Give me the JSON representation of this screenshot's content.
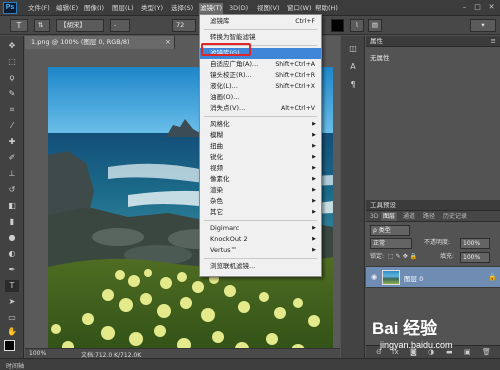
{
  "menubar": {
    "logo": "Ps",
    "items": [
      "文件(F)",
      "编辑(E)",
      "图像(I)",
      "图层(L)",
      "类型(Y)",
      "选择(S)",
      "滤镜(T)",
      "3D(D)",
      "视图(V)",
      "窗口(W)",
      "帮助(H)"
    ],
    "active_index": 6
  },
  "optbar": {
    "font_family": "【胡宋】",
    "font_style": "-",
    "font_size": "72"
  },
  "document": {
    "tab_title": "1.png @ 100% (图层 0, RGB/8)",
    "tab_close": "×",
    "zoom": "100%",
    "doc_size": "文档:712.0 K/712.0K"
  },
  "bottom_bar": {
    "label": "时间轴"
  },
  "filter_menu": {
    "items": [
      {
        "label": "滤镜库",
        "shortcut": "Ctrl+F"
      },
      {
        "sep": true
      },
      {
        "label": "转换为智能滤镜",
        "shortcut": ""
      },
      {
        "sep": true
      },
      {
        "label": "滤镜库(G)...",
        "shortcut": "",
        "highlight": true
      },
      {
        "label": "自适应广角(A)...",
        "shortcut": "Shift+Ctrl+A"
      },
      {
        "label": "镜头校正(R)...",
        "shortcut": "Shift+Ctrl+R"
      },
      {
        "label": "液化(L)...",
        "shortcut": "Shift+Ctrl+X"
      },
      {
        "label": "油画(O)...",
        "shortcut": ""
      },
      {
        "label": "消失点(V)...",
        "shortcut": "Alt+Ctrl+V"
      },
      {
        "sep": true
      },
      {
        "label": "风格化",
        "submenu": true
      },
      {
        "label": "模糊",
        "submenu": true
      },
      {
        "label": "扭曲",
        "submenu": true
      },
      {
        "label": "锐化",
        "submenu": true
      },
      {
        "label": "视频",
        "submenu": true
      },
      {
        "label": "像素化",
        "submenu": true
      },
      {
        "label": "渲染",
        "submenu": true
      },
      {
        "label": "杂色",
        "submenu": true
      },
      {
        "label": "其它",
        "submenu": true
      },
      {
        "sep": true
      },
      {
        "label": "Digimarc",
        "submenu": true
      },
      {
        "label": "KnockOut 2",
        "submenu": true
      },
      {
        "label": "Vertus™",
        "submenu": true
      },
      {
        "sep": true
      },
      {
        "label": "浏览联机滤镜...",
        "shortcut": ""
      }
    ]
  },
  "properties": {
    "title": "属性",
    "content": "无属性"
  },
  "layers": {
    "header": "工具预设",
    "tabs": [
      "3D",
      "图层",
      "通道",
      "路径",
      "历史记录"
    ],
    "active_tab": 1,
    "filter": "ρ 类型",
    "blend_mode": "正常",
    "opacity_label": "不透明度:",
    "opacity": "100%",
    "lock_label": "锁定:",
    "fill_label": "填充:",
    "fill": "100%",
    "layer_name": "图层 0"
  },
  "watermark": {
    "logo": "Bai 经验",
    "url": "jingyan.baidu.com"
  },
  "colors": {
    "menu_highlight": "#3f86d9",
    "annotation": "#e02626"
  }
}
